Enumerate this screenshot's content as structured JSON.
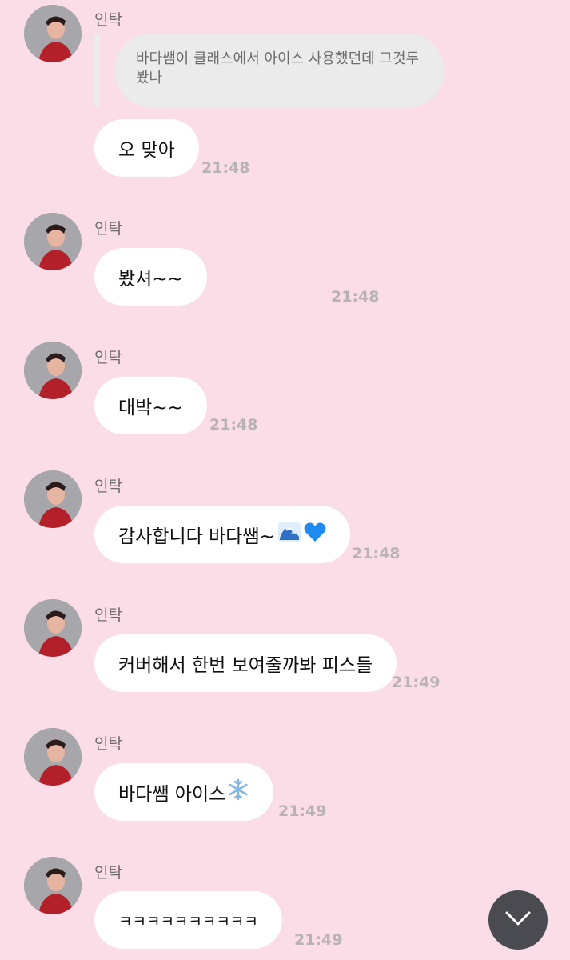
{
  "sender_name": "인탁",
  "quoted_message": "바다쌤이 클래스에서 아이스 사용했던데 그것두 봤나",
  "messages": [
    {
      "text": "오 맞아",
      "time": "21:48"
    },
    {
      "text": "봤셔~~",
      "time": "21:48"
    },
    {
      "text": "대박~~",
      "time": "21:48"
    },
    {
      "text": "감사합니다 바다쌤~",
      "time": "21:48",
      "emoji": [
        "wave-emoji",
        "blue-heart-emoji"
      ]
    },
    {
      "text": "커버해서 한번 보여줄까봐 피스들",
      "time": "21:49"
    },
    {
      "text": "바다쌤 아이스",
      "time": "21:49",
      "emoji": [
        "snowflake-emoji"
      ]
    },
    {
      "text": "ㅋㅋㅋㅋㅋㅋㅋㅋㅋㅋ",
      "time": "21:49"
    }
  ],
  "scroll_button_icon": "chevron-down-icon",
  "colors": {
    "background": "#fadde7",
    "bubble": "#ffffff",
    "quote_bubble": "#ebebeb",
    "timestamp": "#b9b2b5",
    "scroll_button": "#4a4b50"
  }
}
